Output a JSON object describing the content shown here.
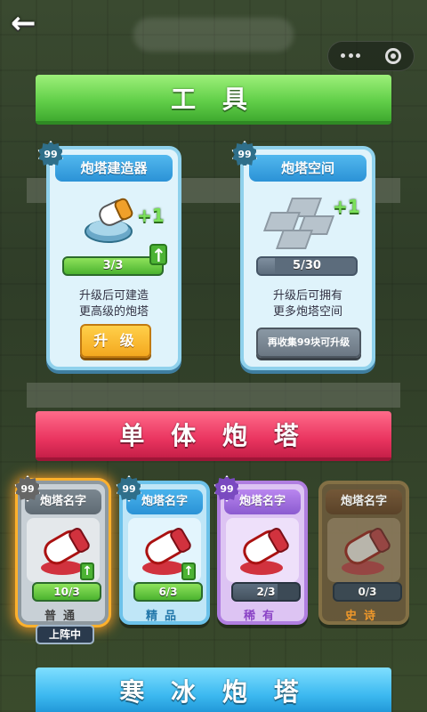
{
  "header": {
    "back_icon": "back-arrow-icon",
    "menu_icon": "more-dots-icon",
    "close_icon": "target-circle-icon"
  },
  "sections": {
    "tools_title": "工 具",
    "single_tower_title": "单 体 炮 塔",
    "ice_tower_title": "寒 冰 炮 塔"
  },
  "tool_cards": [
    {
      "badge": "99",
      "title": "炮塔建造器",
      "plus": "+1",
      "progress_text": "3/3",
      "progress_fraction": 1.0,
      "description_line1": "升级后可建造",
      "description_line2": "更高级的炮塔",
      "button_label": "升 级"
    },
    {
      "badge": "99",
      "title": "炮塔空间",
      "plus": "+1",
      "progress_text": "5/30",
      "progress_fraction": 0.1667,
      "description_line1": "升级后可拥有",
      "description_line2": "更多炮塔空间",
      "button_label": "再收集99块可升级"
    }
  ],
  "towers": [
    {
      "badge": "99",
      "name": "炮塔名字",
      "progress_text": "10/3",
      "progress_fraction": 1.0,
      "rarity": "普通",
      "selected": true
    },
    {
      "badge": "99",
      "name": "炮塔名字",
      "progress_text": "6/3",
      "progress_fraction": 1.0,
      "rarity": "精品",
      "selected": false
    },
    {
      "badge": "99",
      "name": "炮塔名字",
      "progress_text": "2/3",
      "progress_fraction": 0.667,
      "rarity": "稀有",
      "selected": false
    },
    {
      "badge": "",
      "name": "炮塔名字",
      "progress_text": "0/3",
      "progress_fraction": 0.0,
      "rarity": "史诗",
      "selected": false
    }
  ],
  "deployed_label": "上阵中",
  "colors": {
    "tools_ribbon": "#63d04a",
    "single_ribbon": "#ea3560",
    "ice_ribbon": "#3cb9f0",
    "upgrade_button": "#f4a81f"
  }
}
